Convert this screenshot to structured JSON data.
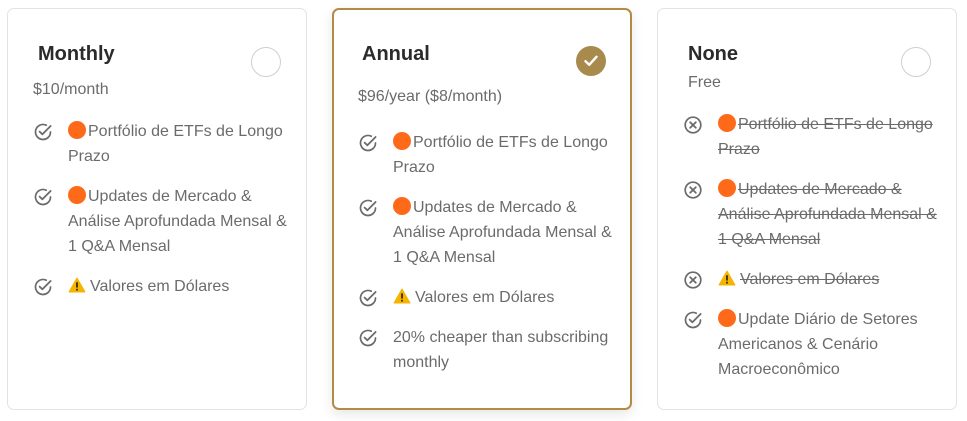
{
  "plans": [
    {
      "title": "Monthly",
      "price": "$10/month",
      "selected": false,
      "features": [
        {
          "icon": "check-circle-icon",
          "included": true,
          "badge": "orange-dot-icon",
          "text": "Portfólio de ETFs de Longo Prazo"
        },
        {
          "icon": "check-circle-icon",
          "included": true,
          "badge": "orange-dot-icon",
          "text": "Updates de Mercado & Análise Aprofundada Mensal & 1 Q&A Mensal"
        },
        {
          "icon": "check-circle-icon",
          "included": true,
          "badge": "warning-icon",
          "text": "Valores em Dólares"
        }
      ]
    },
    {
      "title": "Annual",
      "price": "$96/year ($8/month)",
      "selected": true,
      "features": [
        {
          "icon": "check-circle-icon",
          "included": true,
          "badge": "orange-dot-icon",
          "text": "Portfólio de ETFs de Longo Prazo"
        },
        {
          "icon": "check-circle-icon",
          "included": true,
          "badge": "orange-dot-icon",
          "text": "Updates de Mercado & Análise Aprofundada Mensal & 1 Q&A Mensal"
        },
        {
          "icon": "check-circle-icon",
          "included": true,
          "badge": "warning-icon",
          "text": "Valores em Dólares"
        },
        {
          "icon": "check-circle-icon",
          "included": true,
          "badge": "",
          "text": "20% cheaper than subscribing monthly"
        }
      ]
    },
    {
      "title": "None",
      "price": "Free",
      "selected": false,
      "features": [
        {
          "icon": "x-circle-icon",
          "included": false,
          "badge": "orange-dot-icon",
          "text": "Portfólio de ETFs de Longo Prazo"
        },
        {
          "icon": "x-circle-icon",
          "included": false,
          "badge": "orange-dot-icon",
          "text": "Updates de Mercado & Análise Aprofundada Mensal & 1 Q&A Mensal"
        },
        {
          "icon": "x-circle-icon",
          "included": false,
          "badge": "warning-icon",
          "text": "Valores em Dólares"
        },
        {
          "icon": "check-circle-icon",
          "included": true,
          "badge": "orange-dot-icon",
          "text": "Update Diário de Setores Americanos & Cenário Macroeconômico"
        }
      ]
    }
  ],
  "colors": {
    "accent": "#a88a4c",
    "accent_border": "#b48a48",
    "dot": "#ff6a1a",
    "warning": "#f5b400",
    "text": "#6b6b6b",
    "title": "#2b2b2b"
  }
}
